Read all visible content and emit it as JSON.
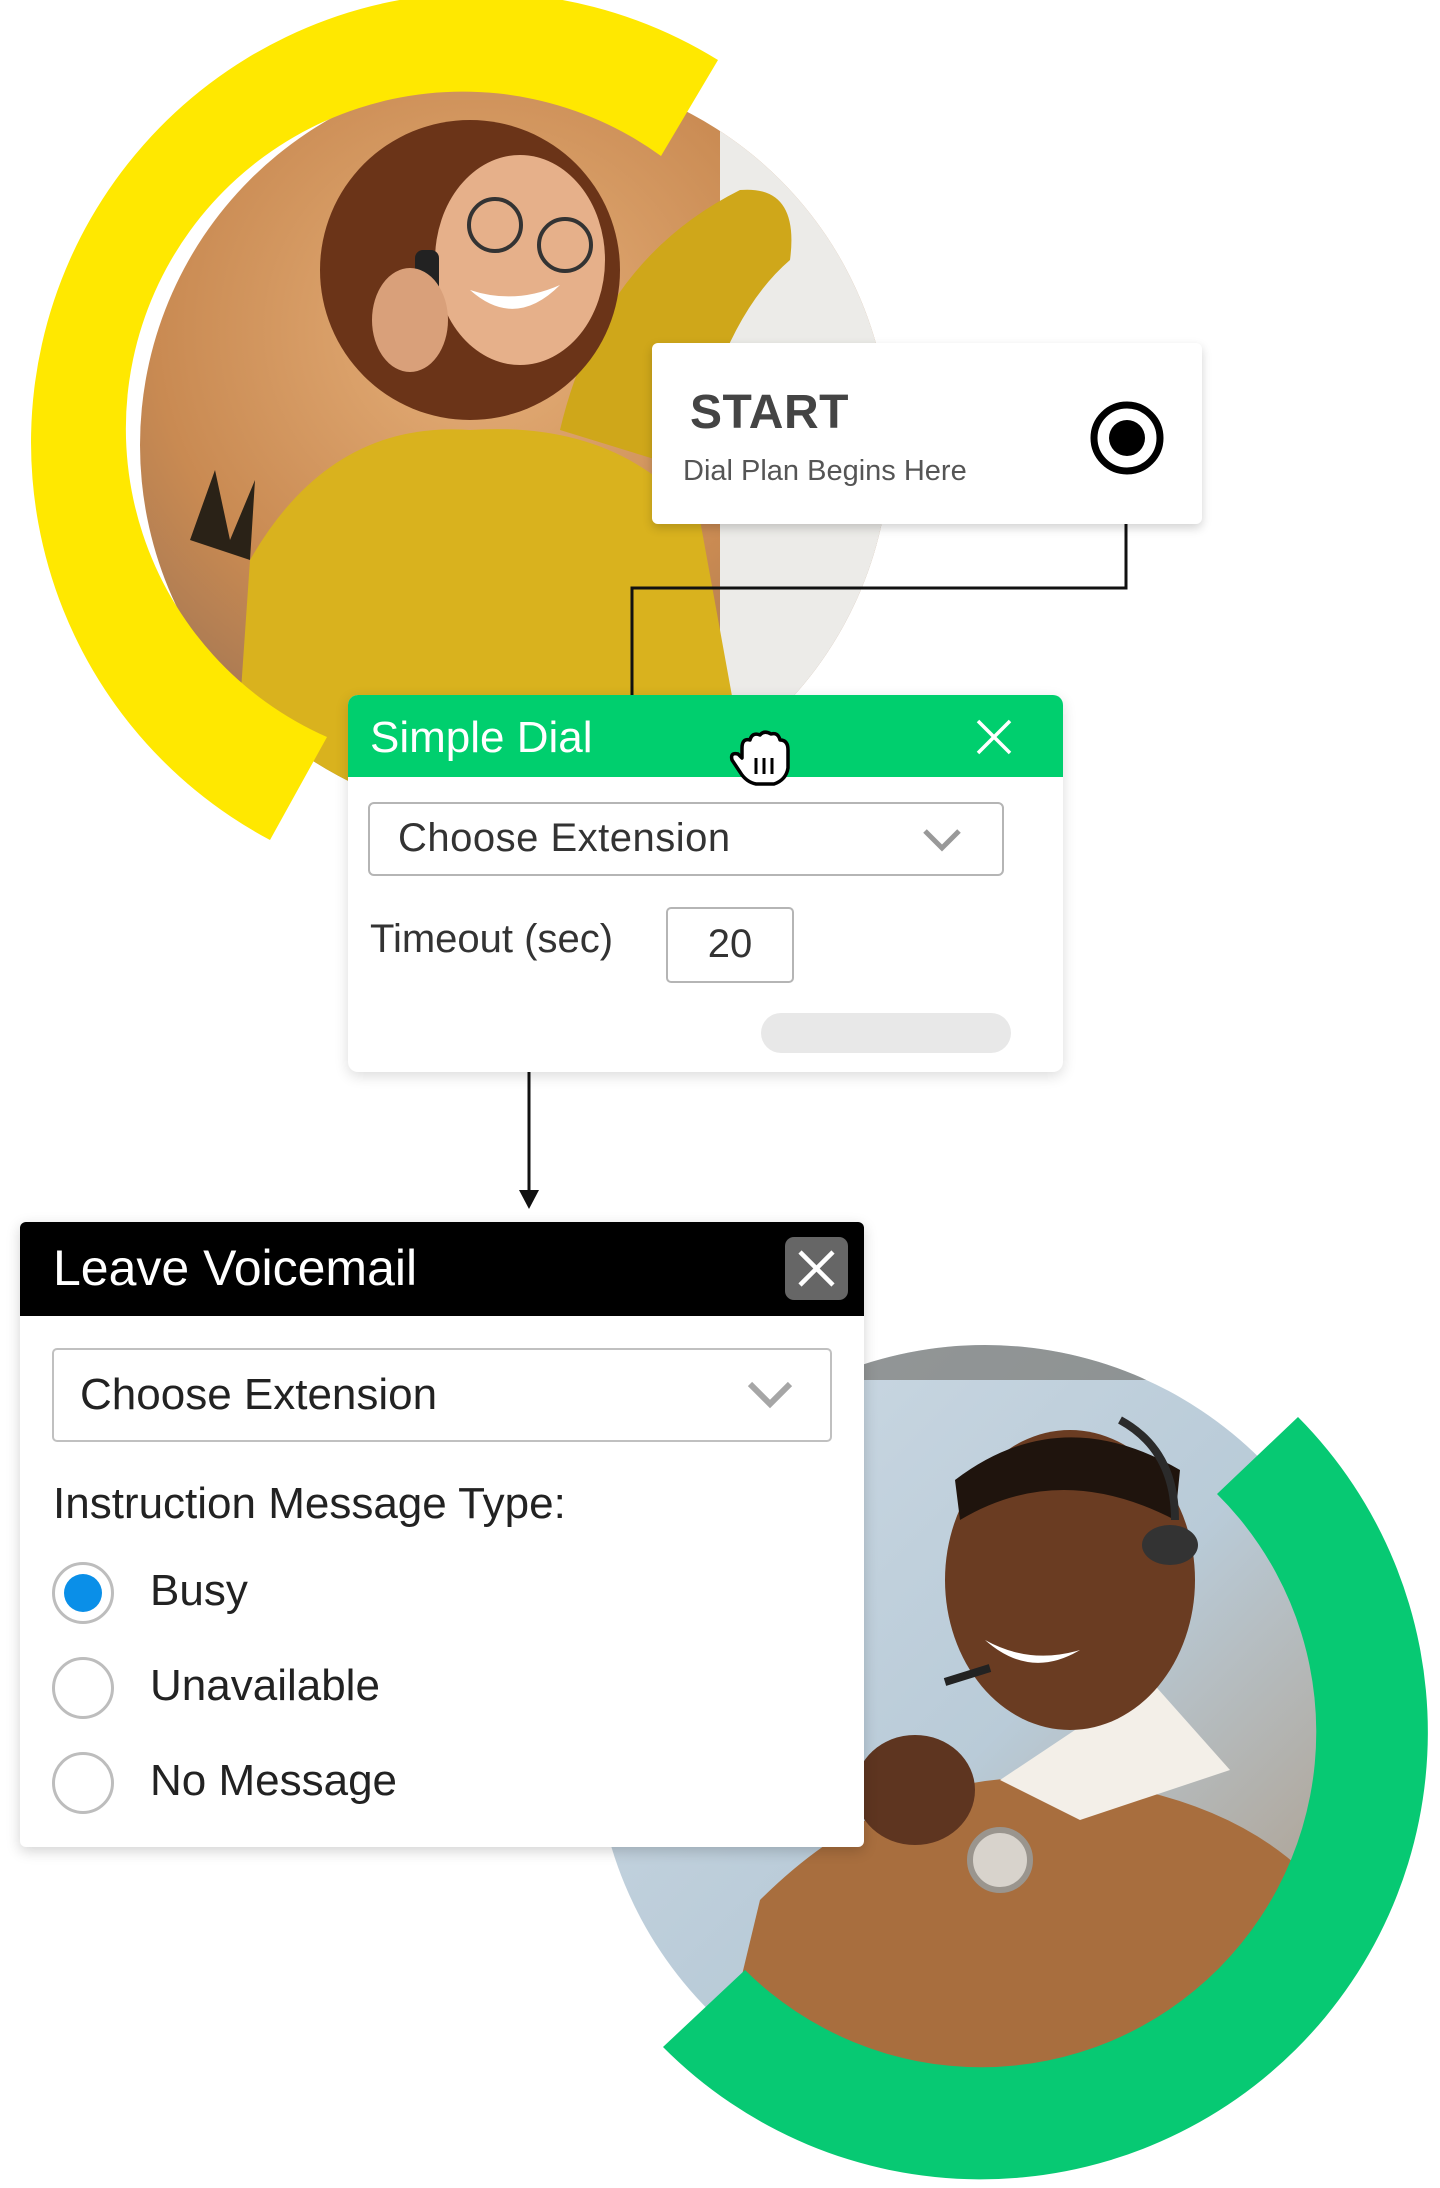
{
  "colors": {
    "yellow_ring": "#ffe800",
    "green_ring": "#07c973",
    "simple_dial_header": "#00cf6e",
    "leave_voicemail_header": "#000000",
    "radio_selected": "#0a8fe8"
  },
  "photos": [
    {
      "subject": "Smiling woman with curly hair and glasses on phone call, yellow sweater"
    },
    {
      "subject": "Smiling man wearing headset, brown sweater and checked shirt"
    }
  ],
  "start_node": {
    "title": "START",
    "subtitle": "Dial Plan Begins Here",
    "icon": "target-connector-icon"
  },
  "simple_dial": {
    "title": "Simple Dial",
    "close_icon": "close-icon",
    "cursor_icon": "grab-hand-cursor-icon",
    "extension_select": {
      "value": "Choose Extension"
    },
    "timeout_label": "Timeout (sec)",
    "timeout_value": "20"
  },
  "leave_voicemail": {
    "title": "Leave Voicemail",
    "close_icon": "close-icon",
    "extension_select": {
      "value": "Choose Extension"
    },
    "message_type_label": "Instruction Message Type:",
    "options": [
      {
        "label": "Busy",
        "selected": true
      },
      {
        "label": "Unavailable",
        "selected": false
      },
      {
        "label": "No Message",
        "selected": false
      }
    ]
  }
}
